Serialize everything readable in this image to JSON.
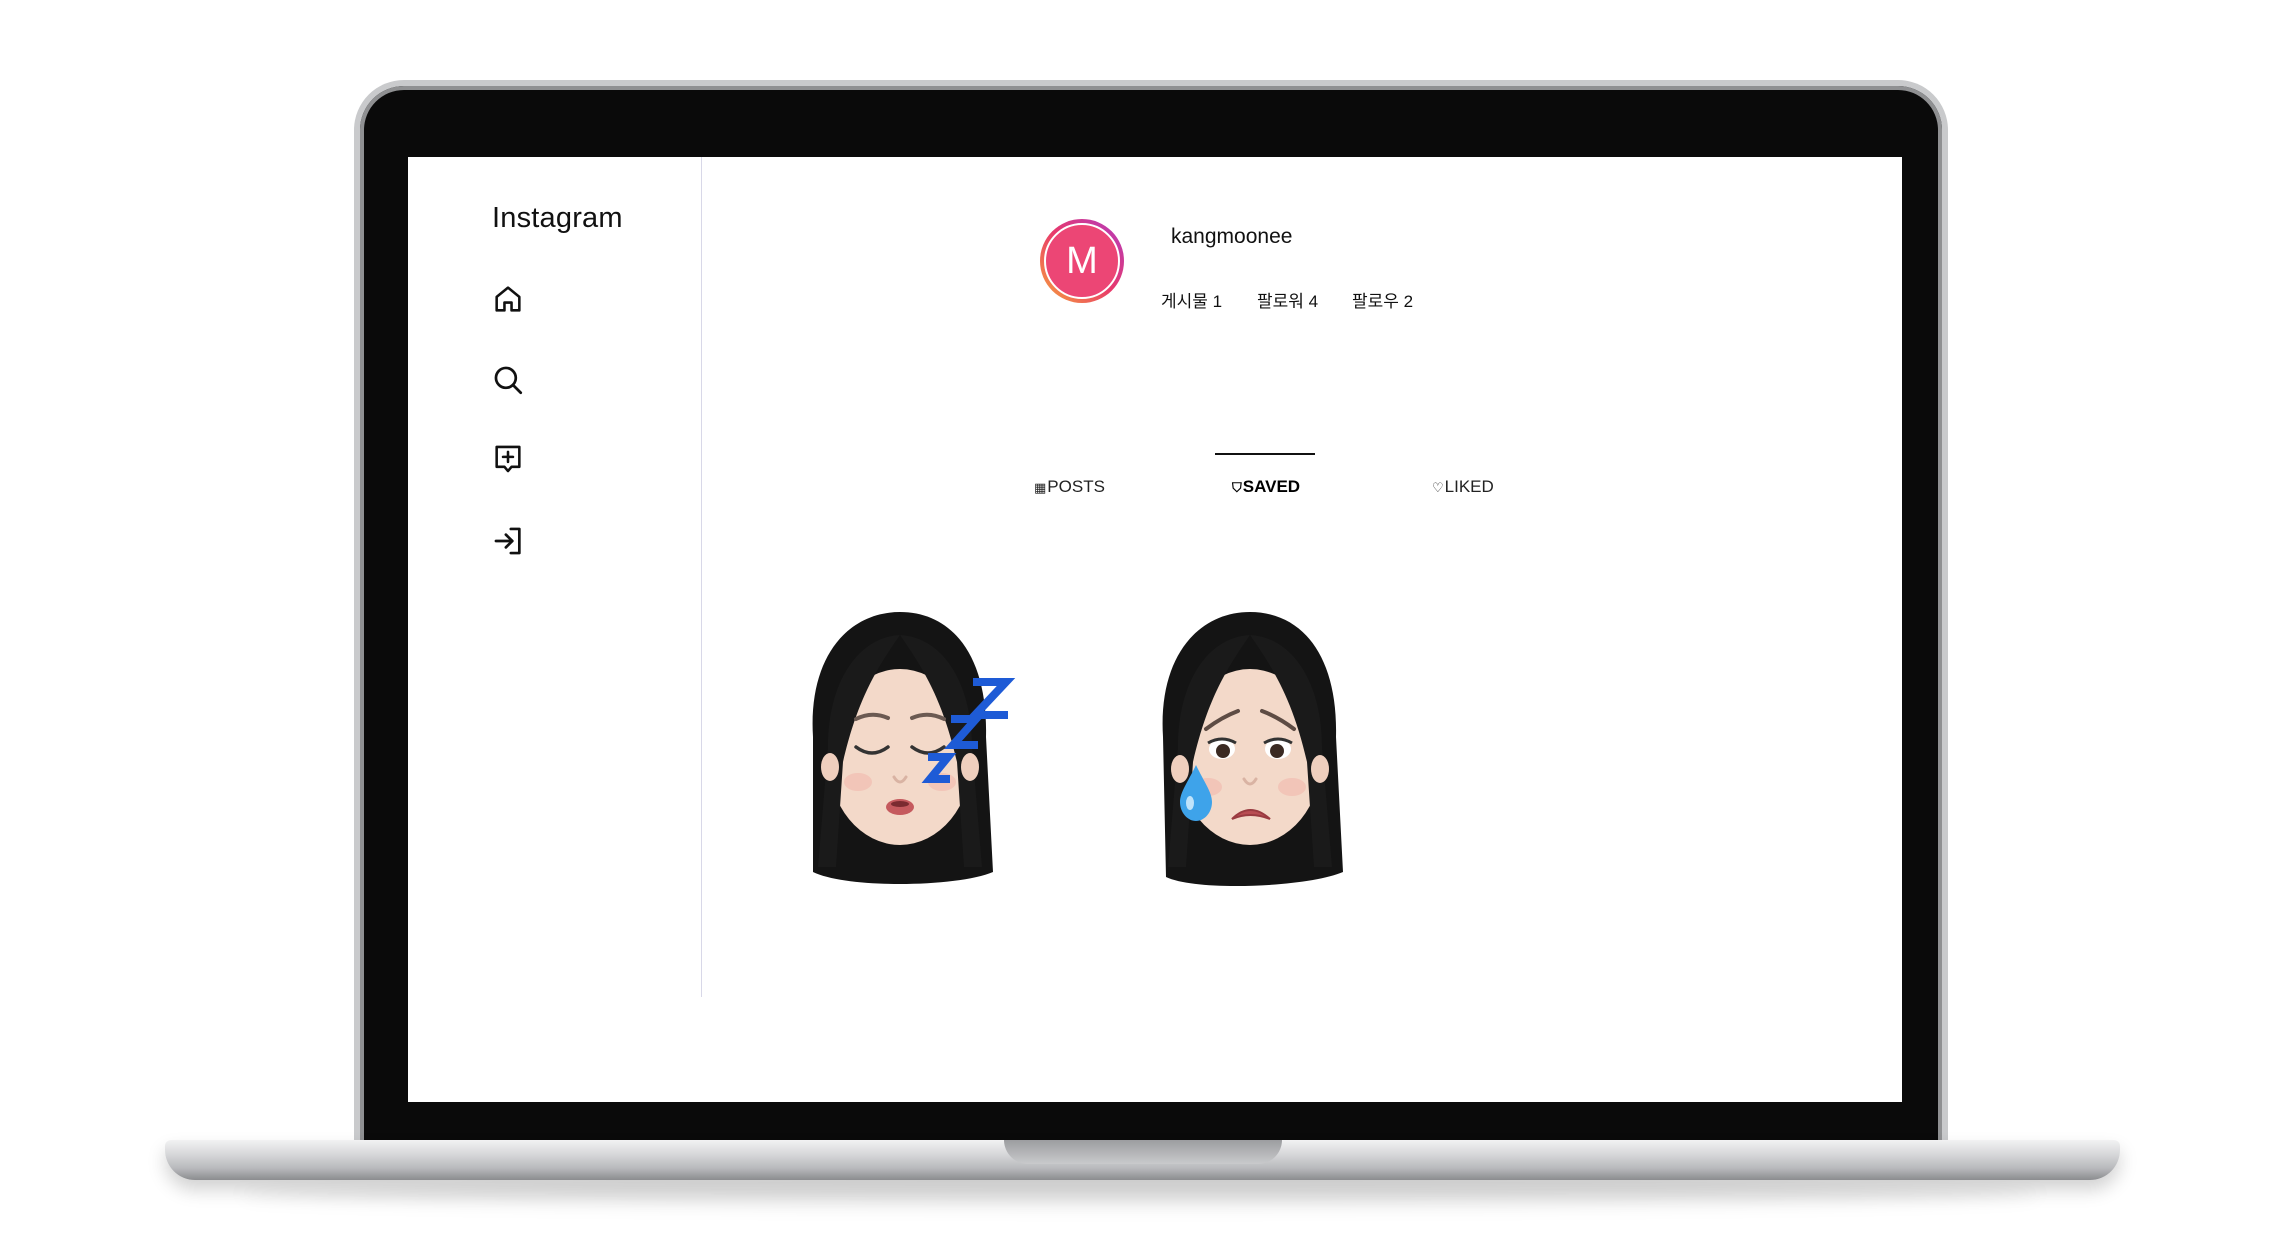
{
  "app": {
    "logo": "Instagram"
  },
  "sidebar": {
    "items": [
      {
        "icon": "home-icon"
      },
      {
        "icon": "search-icon"
      },
      {
        "icon": "add-post-icon"
      },
      {
        "icon": "login-icon"
      }
    ]
  },
  "profile": {
    "avatar_letter": "M",
    "username": "kangmoonee",
    "stats": {
      "posts": "게시물 1",
      "followers": "팔로워 4",
      "following": "팔로우 2"
    }
  },
  "tabs": [
    {
      "label": "POSTS",
      "glyph": "▦",
      "icon": "grid-icon",
      "active": false
    },
    {
      "label": "SAVED",
      "glyph": "⛉",
      "icon": "bookmark-icon",
      "active": true
    },
    {
      "label": "LIKED",
      "glyph": "♡",
      "icon": "heart-icon",
      "active": false
    }
  ],
  "saved_items": [
    {
      "name": "sleeping-memoji"
    },
    {
      "name": "crying-memoji"
    }
  ],
  "colors": {
    "avatar_bg": "#ec4675",
    "sleep_z": "#1e5bd6",
    "tear": "#3ea3ea"
  }
}
